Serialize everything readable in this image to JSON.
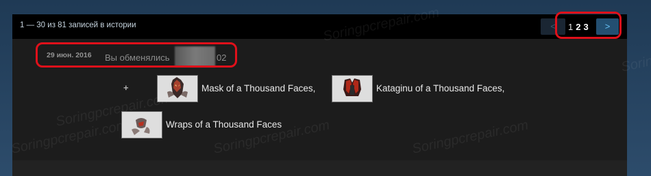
{
  "history": {
    "summary": "1 — 30 из 81 записей в истории",
    "pager": {
      "prev": "<",
      "pages": [
        "1",
        "2",
        "3"
      ],
      "next": ">"
    }
  },
  "trade": {
    "date": "29 июн. 2016",
    "description": "Вы обменялись",
    "description_suffix": "02",
    "plus": "+",
    "items": [
      {
        "name": "Mask of a Thousand Faces,"
      },
      {
        "name": "Kataginu of a Thousand Faces,"
      },
      {
        "name": "Wraps of a Thousand Faces"
      }
    ]
  },
  "watermark": "Soringpcrepair.com",
  "colors": {
    "highlight": "#e0101a",
    "next_button": "#234f71",
    "link": "#67c1f5"
  }
}
